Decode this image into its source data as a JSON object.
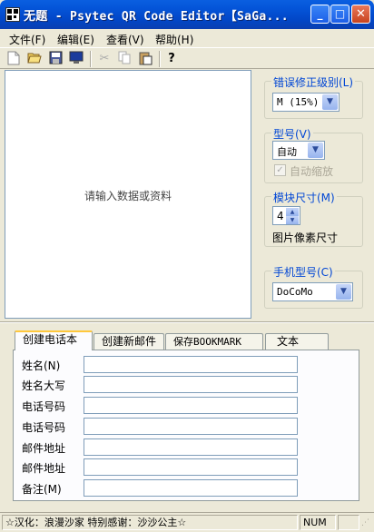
{
  "window": {
    "title": "无题 - Psytec QR Code Editor【SaGa...",
    "minimize": "_",
    "maximize": "□",
    "close": "✕"
  },
  "menu": [
    "文件(F)",
    "编辑(E)",
    "查看(V)",
    "帮助(H)"
  ],
  "toolbar": {
    "icons": [
      "new-icon",
      "open-icon",
      "save-icon",
      "monitor-icon",
      "cut-icon",
      "copy-icon",
      "paste-icon",
      "help-icon"
    ]
  },
  "data_area": {
    "placeholder": "请输入数据或资料"
  },
  "error_correction": {
    "title": "错误修正级别(L)",
    "value": "M (15%)"
  },
  "model": {
    "title": "型号(V)",
    "value": "自动",
    "auto_zoom_label": "自动缩放",
    "auto_zoom_checked": true
  },
  "module_size": {
    "title": "模块尺寸(M)",
    "value": "4",
    "pixel_label": "图片像素尺寸"
  },
  "phone_model": {
    "title": "手机型号(C)",
    "value": "DoCoMo"
  },
  "tabs": [
    "创建电话本",
    "创建新邮件",
    "保存BOOKMARK",
    "文本"
  ],
  "fields": [
    "姓名(N)",
    "姓名大写",
    "电话号码",
    "电话号码",
    "邮件地址",
    "邮件地址",
    "备注(M)"
  ],
  "status": {
    "credits": "☆汉化：浪漫沙家    特别感谢：沙沙公主☆",
    "num": "NUM"
  },
  "colors": {
    "title_bar": "#0454d8",
    "group_title": "#0046d5",
    "face": "#ece9d8"
  }
}
